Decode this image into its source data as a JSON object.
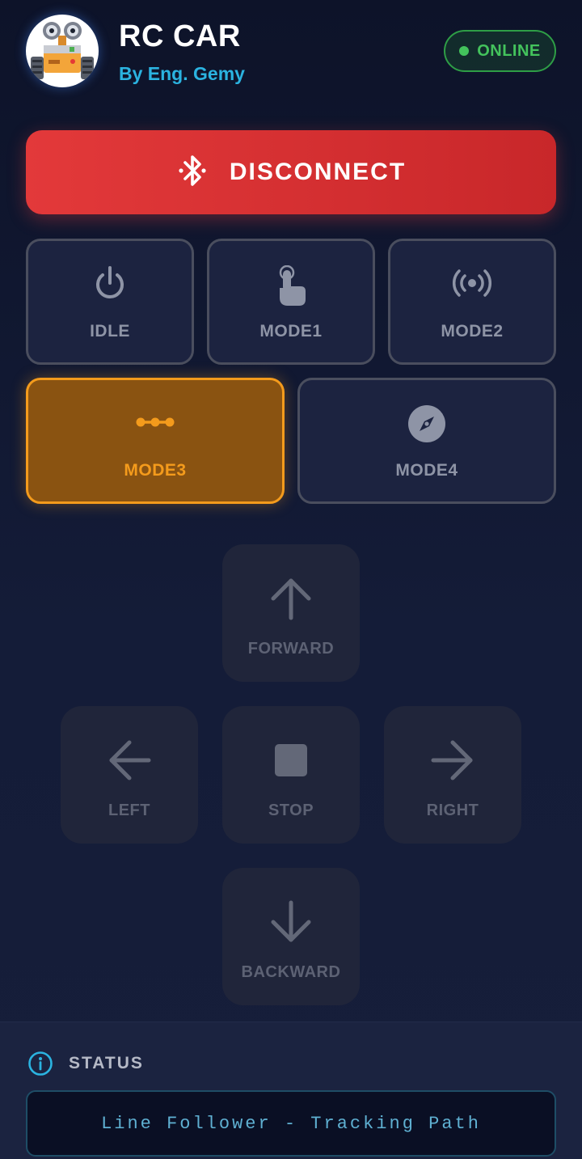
{
  "header": {
    "title": "RC CAR",
    "subtitle": "By Eng. Gemy",
    "status_badge": "ONLINE"
  },
  "connection": {
    "button_label": "DISCONNECT"
  },
  "modes": [
    {
      "label": "IDLE",
      "icon": "power-icon",
      "active": false
    },
    {
      "label": "MODE1",
      "icon": "touch-icon",
      "active": false
    },
    {
      "label": "MODE2",
      "icon": "broadcast-icon",
      "active": false
    },
    {
      "label": "MODE3",
      "icon": "line-dots-icon",
      "active": true
    },
    {
      "label": "MODE4",
      "icon": "compass-icon",
      "active": false
    }
  ],
  "controls": {
    "forward": "FORWARD",
    "left": "LEFT",
    "stop": "STOP",
    "right": "RIGHT",
    "backward": "BACKWARD"
  },
  "status": {
    "heading": "STATUS",
    "message": "Line Follower - Tracking Path"
  },
  "colors": {
    "background": "#0d1329",
    "accent_red": "#e3393a",
    "accent_orange": "#f49b1c",
    "online_green": "#43c35c",
    "subtitle_cyan": "#2bb3e0"
  }
}
